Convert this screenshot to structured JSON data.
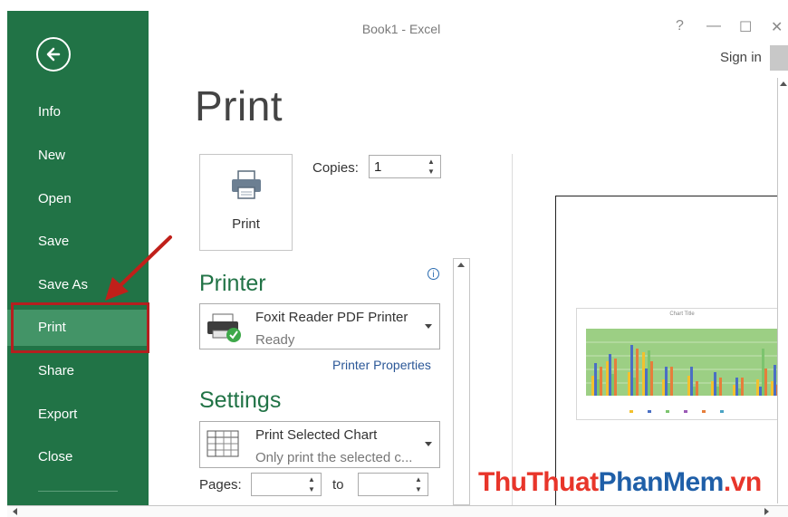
{
  "window": {
    "title": "Book1 - Excel",
    "help": "?",
    "minimize": "—",
    "maximize": "☐",
    "close": "✕",
    "sign_in": "Sign in"
  },
  "sidebar": {
    "items": [
      {
        "label": "Info"
      },
      {
        "label": "New"
      },
      {
        "label": "Open"
      },
      {
        "label": "Save"
      },
      {
        "label": "Save As"
      },
      {
        "label": "Print"
      },
      {
        "label": "Share"
      },
      {
        "label": "Export"
      },
      {
        "label": "Close"
      }
    ],
    "active": "Print"
  },
  "main": {
    "title": "Print",
    "print_button": "Print",
    "copies_label": "Copies:",
    "copies_value": "1",
    "printer_heading": "Printer",
    "printer_name": "Foxit Reader PDF Printer",
    "printer_status": "Ready",
    "printer_properties": "Printer Properties",
    "settings_heading": "Settings",
    "setting_main": "Print Selected Chart",
    "setting_sub": "Only print the selected c...",
    "pages_label": "Pages:",
    "to_label": "to"
  },
  "preview": {
    "chart_title": "Chart Title"
  },
  "watermark": {
    "part1": "ThuThuat",
    "part2": "PhanMem",
    "part3": ".vn"
  },
  "colors": {
    "accent": "#217346",
    "active_item": "#439467",
    "highlight_border": "#b51f1f",
    "arrow": "#c0201a"
  }
}
